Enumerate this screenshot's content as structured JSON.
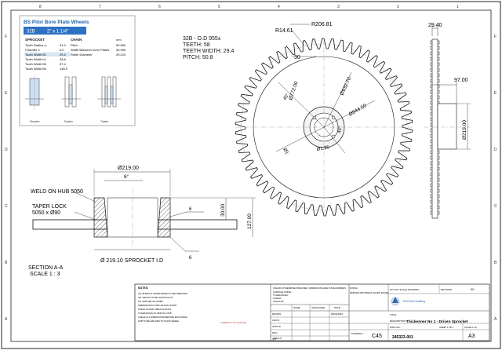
{
  "inset": {
    "title": "BS Pilot Bore Plate Wheels",
    "tab": "32B",
    "size": "2\" x 1.1/4\"",
    "sprocket_header": "SPROCKET",
    "rows": [
      {
        "label": "Tooth Radius r₃",
        "val": "51.0"
      },
      {
        "label": "Chamfer e",
        "val": "6.0"
      },
      {
        "label": "Tooth Width B1",
        "val": "29.4"
      },
      {
        "label": "Tooth Width b1",
        "val": "28.8"
      },
      {
        "label": "Tooth Width B2",
        "val": "87.4"
      },
      {
        "label": "Tooth Width B3",
        "val": "146.0"
      }
    ],
    "chain_header": "CHAIN",
    "unit": "mm",
    "chain_rows": [
      {
        "label": "Pitch",
        "val": "50.800"
      },
      {
        "label": "Width Between Inner Plates",
        "val": "30.990"
      },
      {
        "label": "Roller Diameter",
        "val": "29.210"
      }
    ],
    "fig_labels": [
      "Simplex",
      "Duplex",
      "Triplex"
    ]
  },
  "spec": {
    "line1": "32B - O.D 955±",
    "line2": "TEETH: 58",
    "line3": "TEETH WIDTH: 29.4",
    "line4": "PITCH: 50.8"
  },
  "dims": {
    "r14": "R14.61",
    "r206": "R206.81",
    "d30": "30",
    "d772": "Ø772.00",
    "d932": "Ø932.70",
    "d844": "Ø844.59",
    "a45a": "45°",
    "a45b": "45°",
    "d1": "Ø1",
    "d125": "Ø1.25",
    "d219_side": "Ø219.00",
    "w29": "29.40",
    "w97": "97.00",
    "d219_top": "Ø219.00",
    "e8": "8°",
    "h30": "30.00",
    "h127": "127.00",
    "d21910": "Ø 219.10 SPROCKET I.D",
    "weld1": "6",
    "weld2": "6"
  },
  "notes": {
    "weld": "WELD ON HUB 5050",
    "taper1": "TAPER LOCK",
    "taper2": "5050 x Ø90",
    "section1": "SECTION A-A",
    "section2": "SCALE 1 : 3"
  },
  "border": {
    "top_nums": [
      "8",
      "7",
      "6",
      "5",
      "4",
      "3",
      "2",
      "1"
    ],
    "side_letters": [
      "F",
      "E",
      "D",
      "C",
      "B",
      "A"
    ]
  },
  "title_block": {
    "notes_head": "NOTES:",
    "note_lines": [
      "ALL BURRS & SHARP EDGES TO BE REMOVED",
      "ALL WELDS TO BE CONTINUOUS",
      "NO SPATTER ALLOWED",
      "DIMENSIONS IN MM UNLESS NOTED",
      "FINISH AS PER SPECIFICATION",
      "TOLERANCES AS PER ISO 2768",
      "CHECK ALL DIMENSIONS BEFORE MACHINING",
      "HUB TO BE WELDED TO PLATE WHEEL"
    ],
    "dims_note": "UNLESS OTHERWISE SPECIFIED: DIMENSIONS ARE IN MILLIMETERS",
    "tol_lines": [
      "SURFACE FINISH:",
      "TOLERANCES:",
      "LINEAR:",
      "ANGULAR:"
    ],
    "finish": "FINISH",
    "deburr": "DEBURR AND BREAK SHARP EDGES",
    "name_col": "NAME",
    "sig_col": "SIGNATURE",
    "date_col": "DATE",
    "role_rows": [
      "DRAWN",
      "CHK'D",
      "APPV'D",
      "MFG",
      "Q.A"
    ],
    "drawn_date": "28/04/2024",
    "red_note": "* SUBJECT TO CHANGE",
    "do_not_scale": "DO NOT SCALE DRAWING",
    "revision_lbl": "REVISION",
    "revision": "00",
    "company": "PrecTech Drafting",
    "title_lbl": "TITLE:",
    "desc_lbl": "DESCRIPTION:",
    "description": "Thickenner No 1 - Driven Sprocket",
    "material_lbl": "MATERIAL:",
    "material": "C45",
    "dwg_lbl": "DWG NO.",
    "dwg_no": "245323-001",
    "size": "A3",
    "weight_lbl": "WEIGHT:",
    "scale_lbl": "SCALE:1:10",
    "sheet_lbl": "SHEET 1 OF 1"
  }
}
